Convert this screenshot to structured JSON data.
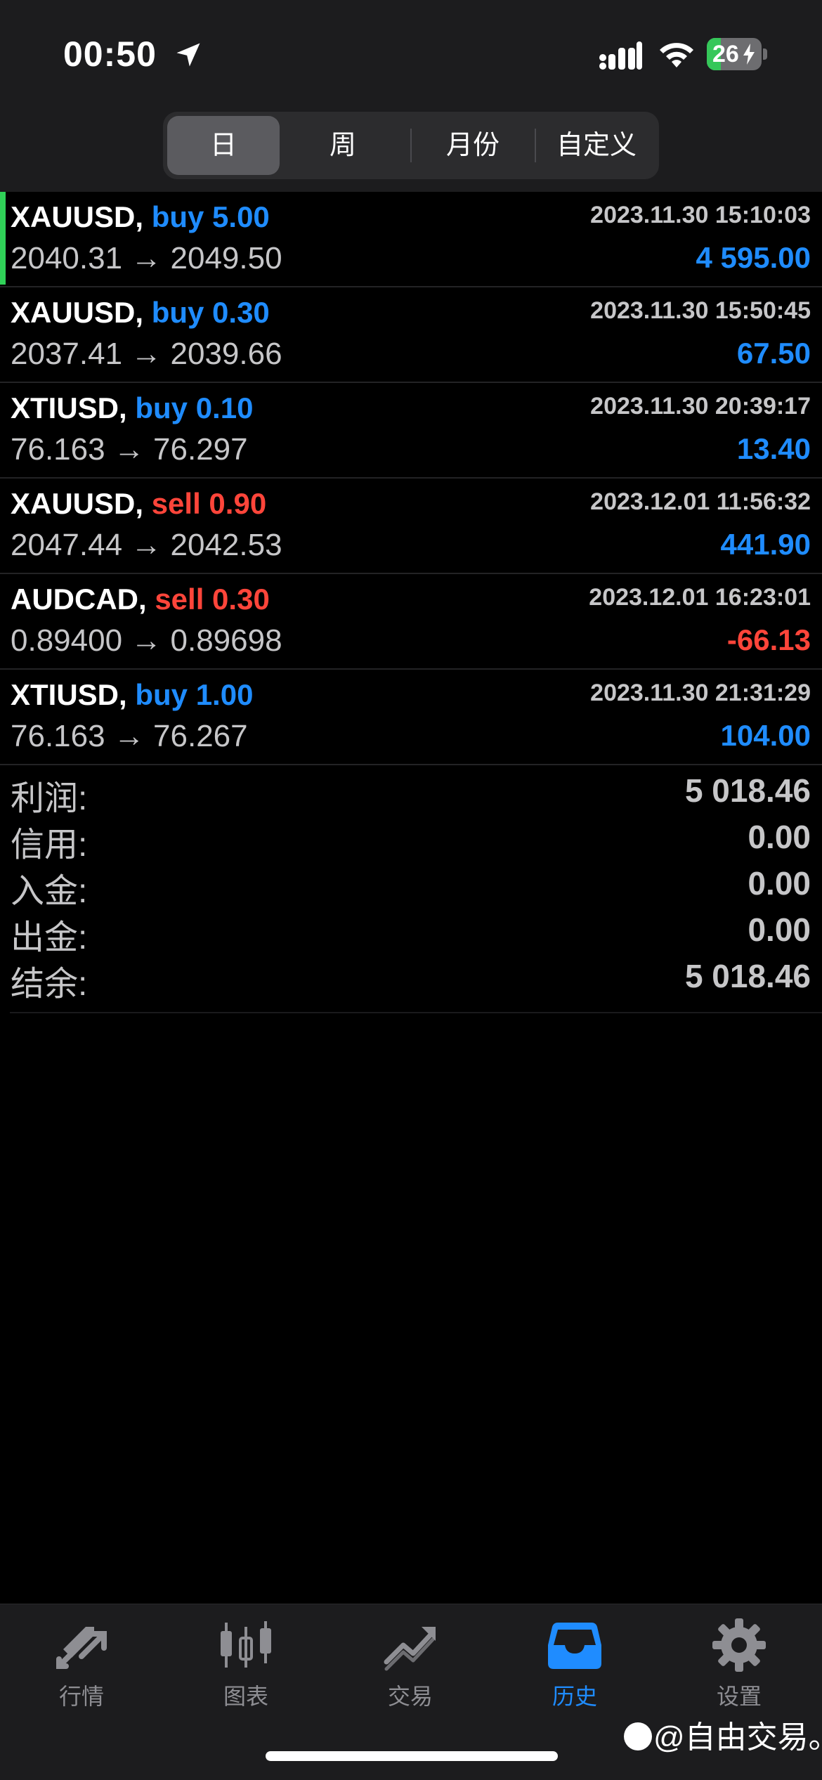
{
  "status_bar": {
    "time": "00:50",
    "battery": "26",
    "battery_level": 0.26,
    "icons": [
      "location-arrow-icon",
      "signal-icon",
      "wifi-icon",
      "battery-charging-icon"
    ]
  },
  "period_tabs": {
    "items": [
      {
        "label": "日",
        "active": true
      },
      {
        "label": "周",
        "active": false
      },
      {
        "label": "月份",
        "active": false
      },
      {
        "label": "自定义",
        "active": false
      }
    ]
  },
  "trades": [
    {
      "symbol": "XAUUSD,",
      "side": "buy",
      "volume": "5.00",
      "side_volume": "buy 5.00",
      "datetime": "2023.11.30 15:10:03",
      "prices": "2040.31 → 2049.50",
      "profit": "4 595.00",
      "profit_sign": "pos"
    },
    {
      "symbol": "XAUUSD,",
      "side": "buy",
      "volume": "0.30",
      "side_volume": "buy 0.30",
      "datetime": "2023.11.30 15:50:45",
      "prices": "2037.41 → 2039.66",
      "profit": "67.50",
      "profit_sign": "pos"
    },
    {
      "symbol": "XTIUSD,",
      "side": "buy",
      "volume": "0.10",
      "side_volume": "buy 0.10",
      "datetime": "2023.11.30 20:39:17",
      "prices": "76.163 → 76.297",
      "profit": "13.40",
      "profit_sign": "pos"
    },
    {
      "symbol": "XAUUSD,",
      "side": "sell",
      "volume": "0.90",
      "side_volume": "sell 0.90",
      "datetime": "2023.12.01 11:56:32",
      "prices": "2047.44 → 2042.53",
      "profit": "441.90",
      "profit_sign": "pos"
    },
    {
      "symbol": "AUDCAD,",
      "side": "sell",
      "volume": "0.30",
      "side_volume": "sell 0.30",
      "datetime": "2023.12.01 16:23:01",
      "prices": "0.89400 → 0.89698",
      "profit": "-66.13",
      "profit_sign": "neg"
    },
    {
      "symbol": "XTIUSD,",
      "side": "buy",
      "volume": "1.00",
      "side_volume": "buy 1.00",
      "datetime": "2023.11.30 21:31:29",
      "prices": "76.163 → 76.267",
      "profit": "104.00",
      "profit_sign": "pos"
    }
  ],
  "summary": [
    {
      "label": "利润:",
      "value": "5 018.46"
    },
    {
      "label": "信用:",
      "value": "0.00"
    },
    {
      "label": "入金:",
      "value": "0.00"
    },
    {
      "label": "出金:",
      "value": "0.00"
    },
    {
      "label": "结余:",
      "value": "5 018.46"
    }
  ],
  "tab_bar": {
    "items": [
      {
        "label": "行情",
        "icon": "quotes-arrows-icon",
        "active": false
      },
      {
        "label": "图表",
        "icon": "candlestick-chart-icon",
        "active": false
      },
      {
        "label": "交易",
        "icon": "trade-trend-icon",
        "active": false
      },
      {
        "label": "历史",
        "icon": "history-inbox-icon",
        "active": true
      },
      {
        "label": "设置",
        "icon": "gear-icon",
        "active": false
      }
    ]
  },
  "watermark": "@自由交易。",
  "colors": {
    "buy": "#1f8cff",
    "sell": "#ff453a",
    "active_tab": "#1f8cff",
    "first_row_marker": "#30d158",
    "battery_fill": "#35c759"
  }
}
